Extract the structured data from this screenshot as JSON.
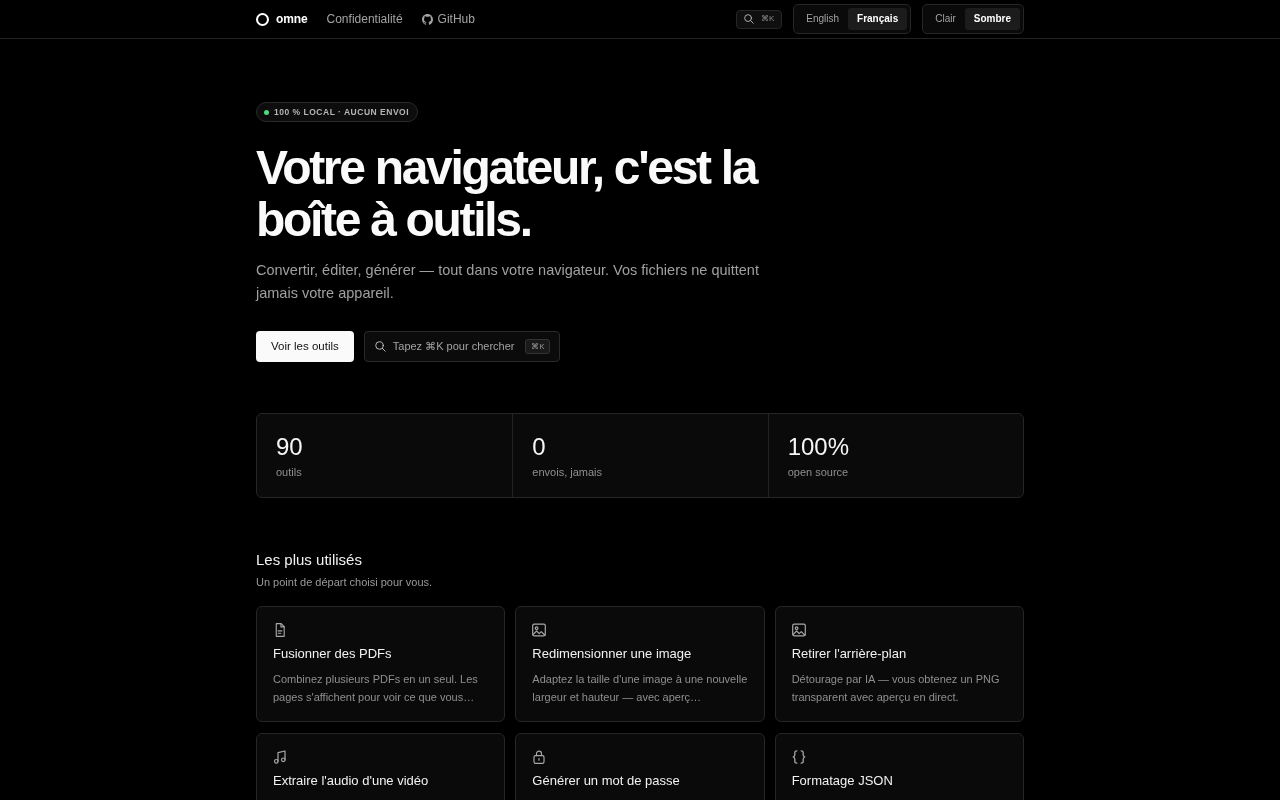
{
  "nav": {
    "brand": "omne",
    "links": [
      {
        "kind": "page",
        "label": "Confidentialité"
      },
      {
        "kind": "repository",
        "label": "GitHub"
      }
    ],
    "search_shortcut": "⌘K",
    "languages": [
      {
        "label": "English",
        "selected": false
      },
      {
        "label": "Français",
        "selected": true
      }
    ],
    "themes": [
      {
        "label": "Clair",
        "selected": false
      },
      {
        "label": "Sombre",
        "selected": true
      }
    ]
  },
  "hero": {
    "badge": "100 % LOCAL · AUCUN ENVOI",
    "title": "Votre navigateur, c'est la boîte à outils.",
    "subtitle": "Convertir, éditer, générer — tout dans votre navigateur. Vos fichiers ne quittent jamais votre appareil.",
    "primary_button": "Voir les outils",
    "search_button": {
      "label": "Tapez ⌘K pour chercher",
      "shortcut": "⌘K"
    }
  },
  "stats": [
    {
      "value": "90",
      "label": "outils"
    },
    {
      "value": "0",
      "label": "envois, jamais"
    },
    {
      "value": "100%",
      "label": "open source"
    }
  ],
  "popular": {
    "title": "Les plus utilisés",
    "subtitle": "Un point de départ choisi pour vous.",
    "tools": [
      {
        "kind": "pdf",
        "title": "Fusionner des PDFs",
        "description": "Combinez plusieurs PDFs en un seul. Les pages s'affichent pour voir ce que vous…"
      },
      {
        "kind": "image",
        "title": "Redimensionner une image",
        "description": "Adaptez la taille d'une image à une nouvelle largeur et hauteur — avec aperç…"
      },
      {
        "kind": "image",
        "title": "Retirer l'arrière-plan",
        "description": "Détourage par IA — vous obtenez un PNG transparent avec aperçu en direct."
      },
      {
        "kind": "audio",
        "title": "Extraire l'audio d'une vidéo"
      },
      {
        "kind": "password",
        "title": "Générer un mot de passe"
      },
      {
        "kind": "json",
        "title": "Formatage JSON"
      }
    ]
  }
}
